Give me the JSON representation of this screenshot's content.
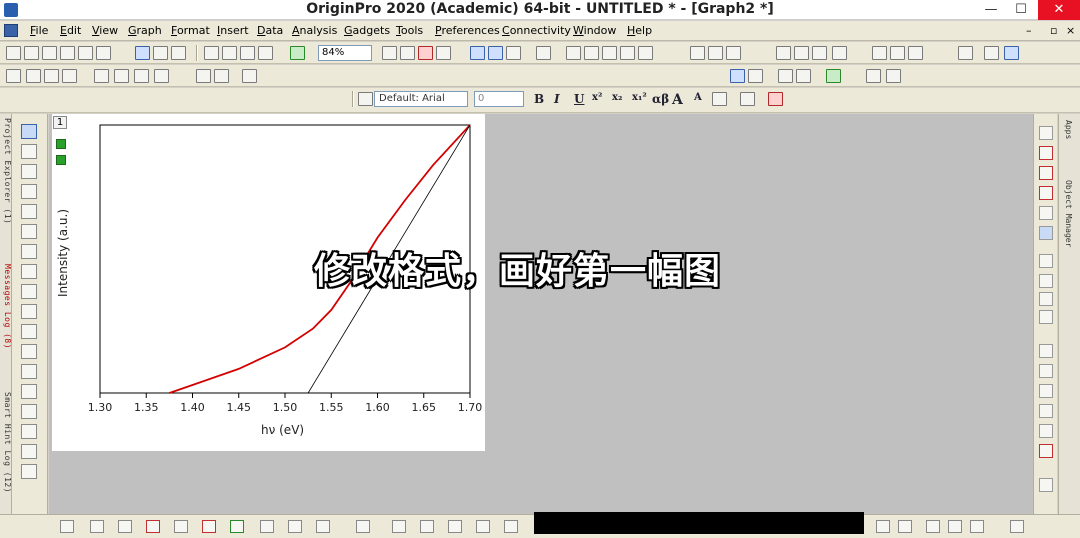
{
  "window": {
    "title": "OriginPro 2020 (Academic) 64-bit - UNTITLED * - [Graph2 *]",
    "minimize": "—",
    "maximize": "☐",
    "close": "✕"
  },
  "menu": {
    "items": [
      "File",
      "Edit",
      "View",
      "Graph",
      "Format",
      "Insert",
      "Data",
      "Analysis",
      "Gadgets",
      "Tools",
      "Preferences",
      "Connectivity",
      "Window",
      "Help"
    ],
    "mdi_min": "–",
    "mdi_restore": "▫",
    "mdi_close": "×"
  },
  "toolbar": {
    "zoom_value": "84%",
    "font_name": "Default: Arial",
    "font_size": "0",
    "bold": "B",
    "italic": "I",
    "underline": "U",
    "superscript": "x²",
    "subscript": "x₂",
    "supsub": "x₁²",
    "greek": "αβ",
    "grow_font": "A",
    "shrink_font": "A"
  },
  "side_panels": {
    "project_explorer": "Project Explorer (1)",
    "messages_log": "Messages Log (8)",
    "smart_hint_log": "Smart Hint Log (12)",
    "apps": "Apps",
    "object_manager": "Object Manager"
  },
  "graph": {
    "layer_number": "1",
    "overlay_caption": "修改格式，画好第一幅图"
  },
  "chart_data": {
    "type": "line",
    "title": "",
    "xlabel": "hν (eV)",
    "ylabel": "Intensity (a.u.)",
    "xlim": [
      1.3,
      1.7
    ],
    "ylim": [
      0,
      1
    ],
    "xticks": [
      "1.30",
      "1.35",
      "1.40",
      "1.45",
      "1.50",
      "1.55",
      "1.60",
      "1.65",
      "1.70"
    ],
    "grid": false,
    "series": [
      {
        "color": "#d40000",
        "x": [
          1.375,
          1.4,
          1.45,
          1.5,
          1.53,
          1.55,
          1.57,
          1.6,
          1.63,
          1.66,
          1.7
        ],
        "y": [
          0.0,
          0.03,
          0.09,
          0.17,
          0.24,
          0.31,
          0.41,
          0.58,
          0.72,
          0.85,
          1.0
        ]
      },
      {
        "color": "#000000",
        "x": [
          1.525,
          1.7
        ],
        "y": [
          0.0,
          1.0
        ]
      }
    ]
  }
}
